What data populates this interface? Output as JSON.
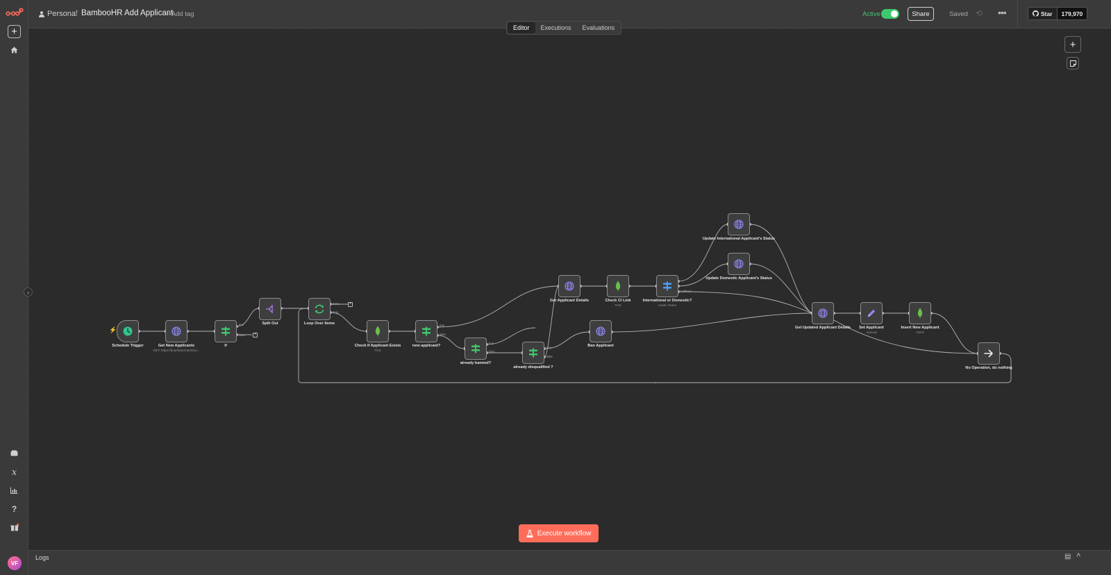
{
  "header": {
    "project": "Personal",
    "workflow_title": "BambooHR Add Applicant",
    "add_tag": "+ Add tag",
    "active_label": "Active",
    "share_label": "Share",
    "saved_label": "Saved",
    "github_star": "Star",
    "github_count": "179,970"
  },
  "tabs": [
    {
      "label": "Editor",
      "active": true
    },
    {
      "label": "Executions",
      "active": false
    },
    {
      "label": "Evaluations",
      "active": false
    }
  ],
  "execute_label": "Execute workflow",
  "logs_label": "Logs",
  "user_initials": "VF",
  "colors": {
    "accent": "#ff6d5a",
    "active_green": "#3ec86c",
    "globe": "#8f87f1",
    "if_green": "#3ec86c",
    "mongo": "#6abf4b",
    "switch_blue": "#4a9eff"
  },
  "nodes": [
    {
      "id": "schedule",
      "name": "Schedule Trigger",
      "sub": "",
      "icon": "clock-icon"
    },
    {
      "id": "getnew",
      "name": "Get New Applicants",
      "sub": "GET: https://[markland.bamboo...",
      "icon": "globe-icon"
    },
    {
      "id": "if",
      "name": "If",
      "sub": "",
      "icon": "if-icon"
    },
    {
      "id": "splitout",
      "name": "Split Out",
      "sub": "",
      "icon": "split-icon"
    },
    {
      "id": "loop",
      "name": "Loop Over Items",
      "sub": "",
      "icon": "loop-icon"
    },
    {
      "id": "checkexists",
      "name": "Check If Applicant Exists",
      "sub": "Find",
      "icon": "mongodb-icon"
    },
    {
      "id": "newapp",
      "name": "new applicant?",
      "sub": "",
      "icon": "if-icon"
    },
    {
      "id": "banned",
      "name": "already banned?",
      "sub": "",
      "icon": "if-icon"
    },
    {
      "id": "disq",
      "name": "already disqualified ?",
      "sub": "",
      "icon": "if-icon"
    },
    {
      "id": "getdetails",
      "name": "Get Applicant Details",
      "sub": "",
      "icon": "globe-icon"
    },
    {
      "id": "checkcv",
      "name": "Check CI Link",
      "sub": "Find",
      "icon": "mongodb-icon"
    },
    {
      "id": "intdom",
      "name": "International or Domestic?",
      "sub": "mode: Rules",
      "icon": "switch-icon"
    },
    {
      "id": "ban",
      "name": "Ban Applicant",
      "sub": "",
      "icon": "globe-icon"
    },
    {
      "id": "updint",
      "name": "Update International Applicant's Status",
      "sub": "",
      "icon": "globe-icon"
    },
    {
      "id": "upddom",
      "name": "Update Domestic Applicant's Status",
      "sub": "",
      "icon": "globe-icon"
    },
    {
      "id": "getupdated",
      "name": "Get Updated Applicant Details",
      "sub": "",
      "icon": "globe-icon"
    },
    {
      "id": "setapp",
      "name": "Set Applicant",
      "sub": "manual",
      "icon": "pencil-icon"
    },
    {
      "id": "insertnew",
      "name": "Insert New Applicant",
      "sub": "insert",
      "icon": "mongodb-icon"
    },
    {
      "id": "noop",
      "name": "No Operation, do nothing",
      "sub": "",
      "icon": "arrow-right-icon"
    }
  ],
  "port_labels": {
    "if_true": "true",
    "if_false": "false",
    "loop_done": "done",
    "loop_loop": "loop",
    "newapp_true": "true",
    "newapp_false": "false",
    "banned_true": "true",
    "banned_false": "false",
    "disq_true": "true",
    "disq_false": "false",
    "intdom_fallback": "Fallback"
  }
}
